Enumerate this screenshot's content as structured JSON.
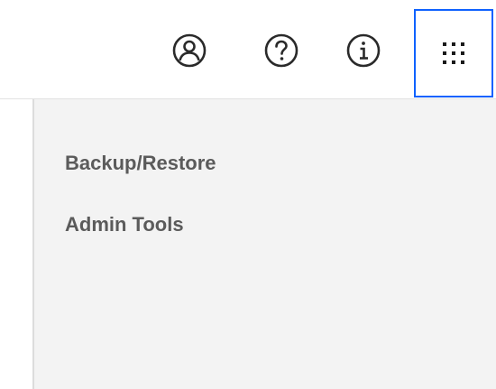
{
  "header": {
    "icons": {
      "user": "user-avatar-icon",
      "help": "help-icon",
      "info": "information-icon",
      "apps": "app-switcher-icon"
    },
    "accent_color": "#0f62fe"
  },
  "menu": {
    "items": [
      {
        "label": "Backup/Restore"
      },
      {
        "label": "Admin Tools"
      }
    ]
  }
}
